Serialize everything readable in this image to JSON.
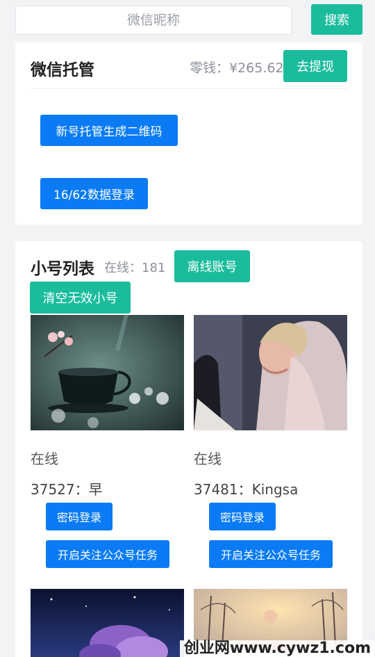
{
  "search": {
    "placeholder": "微信昵称",
    "button_label": "搜索"
  },
  "hosting": {
    "title": "微信托管",
    "balance_label": "零钱：¥265.62",
    "withdraw_label": "去提现",
    "new_qr_label": "新号托管生成二维码",
    "data_login_label": "16/62数据登录"
  },
  "accounts": {
    "title": "小号列表",
    "online_label": "在线：181",
    "offline_button_label": "离线账号",
    "clear_invalid_label": "清空无效小号",
    "items": [
      {
        "status": "在线",
        "id_label": "37527：早",
        "password_login_label": "密码登录",
        "follow_task_label": "开启关注公众号任务",
        "image": "tea-cup-blossom-photo"
      },
      {
        "status": "在线",
        "id_label": "37481：Kingsa",
        "password_login_label": "密码登录",
        "follow_task_label": "开启关注公众号任务",
        "image": "bride-veil-photo"
      },
      {
        "image": "night-sky-clouds-photo"
      },
      {
        "image": "snowy-trees-sunset-photo"
      }
    ]
  },
  "watermark": {
    "text": "创业网www.cywz1.com"
  }
}
